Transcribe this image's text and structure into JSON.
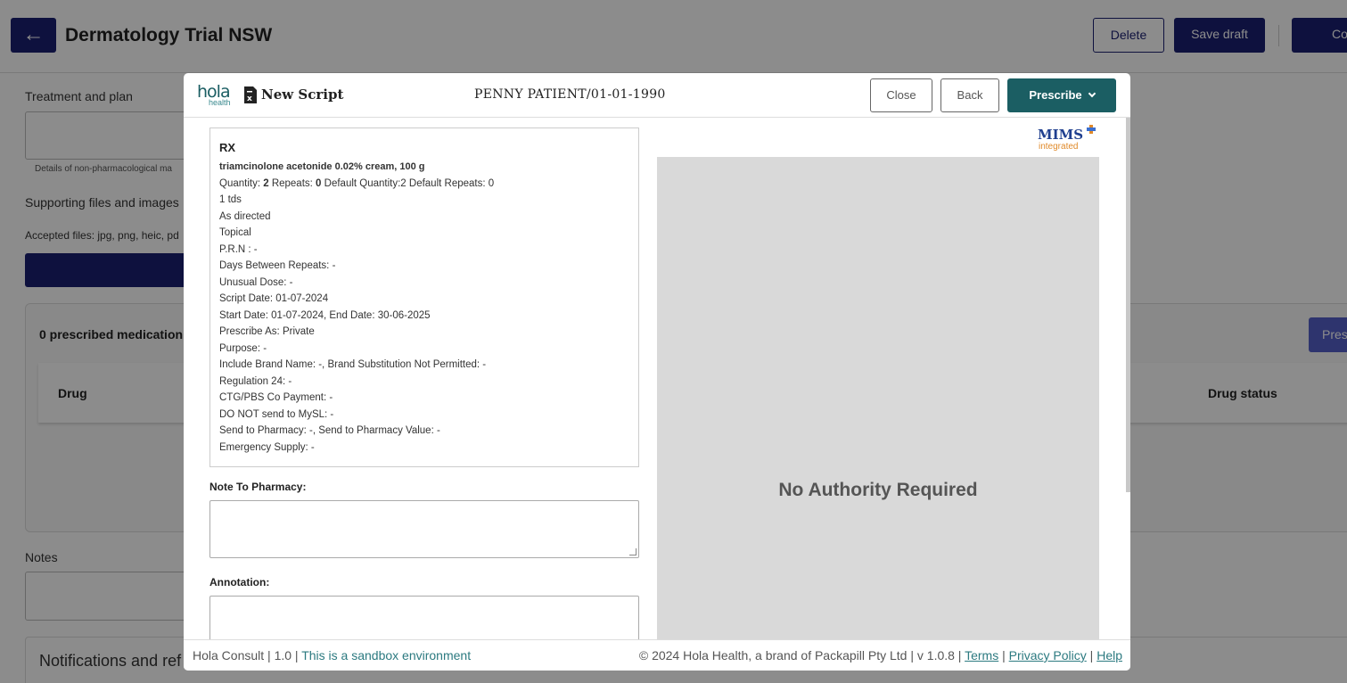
{
  "page": {
    "title": "Dermatology Trial NSW",
    "buttons": {
      "delete": "Delete",
      "save_draft": "Save draft",
      "complete": "Co"
    },
    "treatment_label": "Treatment and plan",
    "treatment_hint": "Details of non-pharmacological ma",
    "supporting_label": "Supporting files and images",
    "accepted_files": "Accepted files: jpg, png, heic, pd",
    "prescribed_count": "0 prescribed medication",
    "prescribe_button": "Pres",
    "table_headers": {
      "drug": "Drug",
      "drug_status": "Drug status"
    },
    "notes_label": "Notes",
    "notifications_label": "Notifications and ref"
  },
  "modal": {
    "brand": {
      "word": "hola",
      "sub": "health"
    },
    "title": "New Script",
    "patient": "PENNY PATIENT/01-01-1990",
    "buttons": {
      "close": "Close",
      "back": "Back",
      "prescribe": "Prescribe"
    },
    "rx": {
      "title": "RX",
      "drug": "triamcinolone acetonide 0.02% cream, 100 g",
      "quantity_label": "Quantity: ",
      "quantity": "2",
      "repeats_label": " Repeats: ",
      "repeats": "0",
      "defaults": " Default Quantity:2 Default Repeats: 0",
      "lines": [
        "1 tds",
        "As directed",
        "Topical",
        "P.R.N : -",
        "Days Between Repeats: -",
        "Unusual Dose: -",
        "Script Date: 01-07-2024",
        "Start Date: 01-07-2024, End Date: 30-06-2025",
        "Prescribe As: Private",
        "Purpose: -",
        "Include Brand Name: -, Brand Substitution Not Permitted: -",
        "Regulation 24: -",
        "CTG/PBS Co Payment: -",
        "DO NOT send to MySL: -",
        "Send to Pharmacy: -, Send to Pharmacy Value: -",
        "Emergency Supply: -"
      ]
    },
    "note_to_pharmacy_label": "Note To Pharmacy:",
    "annotation_label": "Annotation:",
    "mims": {
      "word": "MIMS",
      "sub": "integrated"
    },
    "authority": "No Authority Required",
    "footer": {
      "app": "Hola Consult",
      "version": "1.0",
      "sandbox": "This is a sandbox environment",
      "copyright": "© 2024 Hola Health, a brand of Packapill Pty Ltd",
      "app_version": "v 1.0.8",
      "terms": "Terms",
      "privacy": "Privacy Policy",
      "help": "Help"
    }
  }
}
